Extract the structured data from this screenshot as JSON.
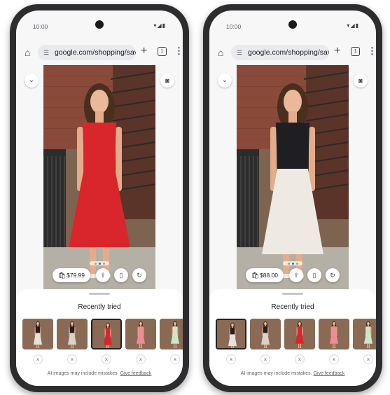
{
  "screens": [
    {
      "status": {
        "time": "10:00",
        "icons_text": "▾◢▮"
      },
      "browser": {
        "url": "google.com/shopping/save",
        "tab_count": "1"
      },
      "outfit": {
        "top_color": "#d9262c",
        "bottom_color": "#d9262c",
        "style": "dress"
      },
      "price": "$79.99",
      "sheet": {
        "title": "Recently tried"
      },
      "selected_index": 2,
      "disclaimer": {
        "text": "AI images may include mistakes.",
        "link": "Give feedback"
      }
    },
    {
      "status": {
        "time": "10:00",
        "icons_text": "▾◢▮"
      },
      "browser": {
        "url": "google.com/shopping/save",
        "tab_count": "1"
      },
      "outfit": {
        "top_color": "#1f1f23",
        "bottom_color": "#eeeae3",
        "style": "top-skirt"
      },
      "price": "$88.00",
      "sheet": {
        "title": "Recently tried"
      },
      "selected_index": 0,
      "disclaimer": {
        "text": "AI images may include mistakes.",
        "link": "Give feedback"
      }
    }
  ],
  "thumbnails": [
    {
      "top": "#1f1f23",
      "bottom": "#e6e2da",
      "dress": false
    },
    {
      "top": "#1f1f23",
      "bottom": "#d9d3c8",
      "dress": false
    },
    {
      "top": "#d9262c",
      "bottom": "#d9262c",
      "dress": true
    },
    {
      "top": "#f08c95",
      "bottom": "#f08c95",
      "dress": true
    },
    {
      "top": "#cfe5c8",
      "bottom": "#cfe5c8",
      "dress": true
    }
  ],
  "icons": {
    "home": "home-icon",
    "tune": "tune-icon",
    "plus": "plus-icon",
    "tabs": "tab-switcher-icon",
    "menu": "more-vert-icon",
    "chevron": "chevron-down-icon",
    "camera": "camera-icon",
    "bag": "shopping-bag-icon",
    "share": "share-icon",
    "bookmark": "bookmark-icon",
    "refresh": "refresh-icon",
    "close": "close-icon"
  }
}
